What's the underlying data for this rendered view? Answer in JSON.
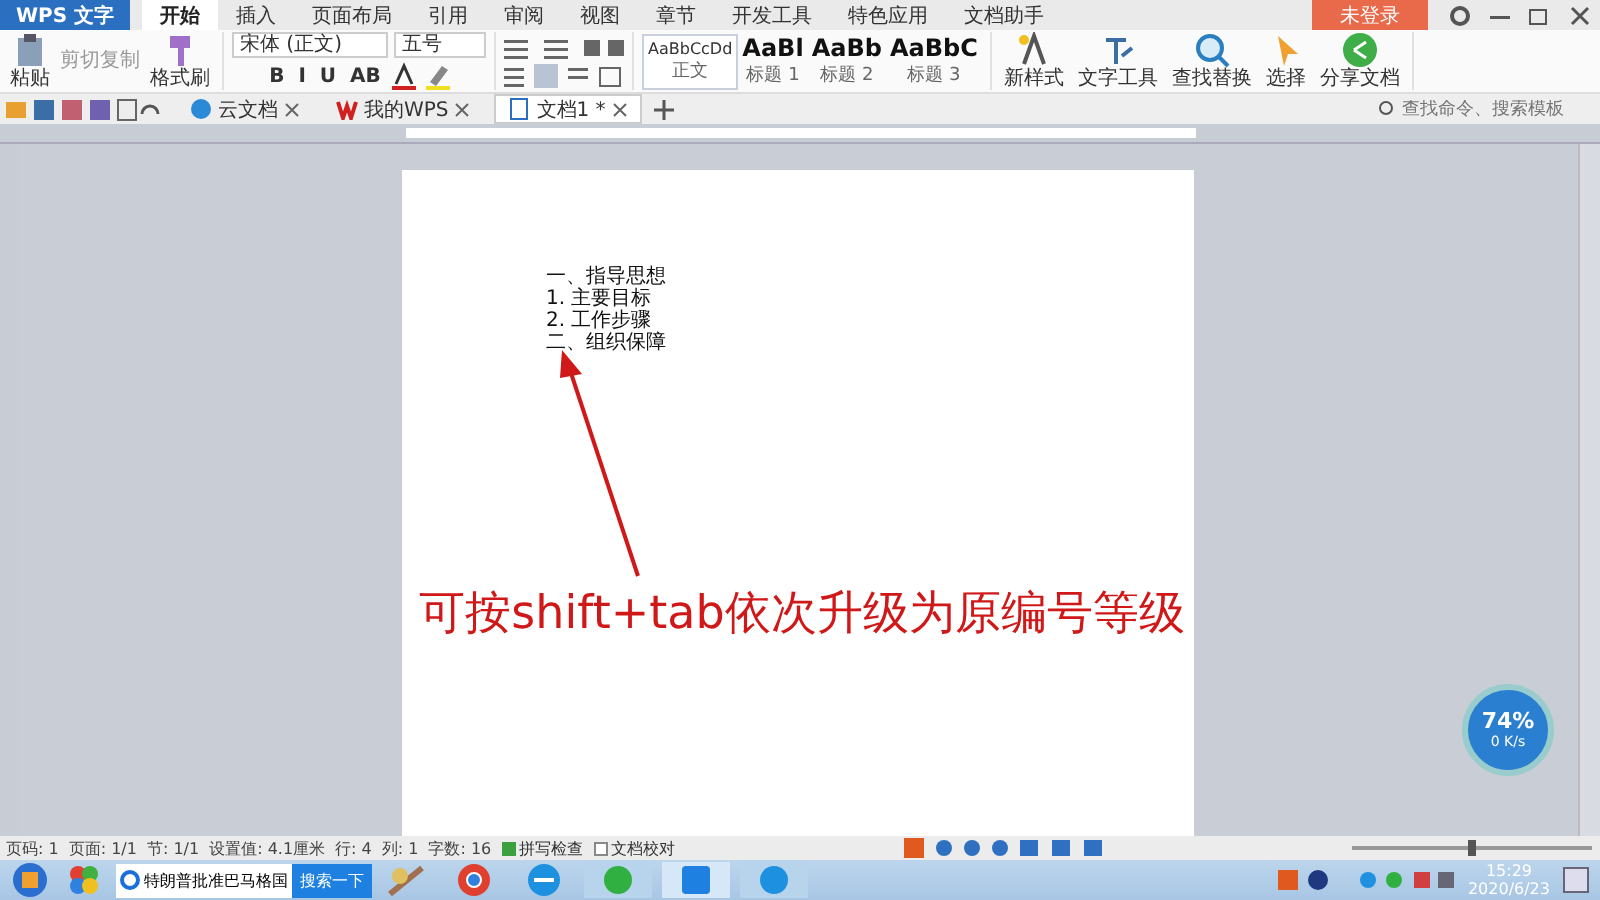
{
  "app_menu": {
    "label": "WPS 文字"
  },
  "tabs": [
    {
      "label": "开始",
      "selected": true
    },
    {
      "label": "插入",
      "selected": false
    },
    {
      "label": "页面布局",
      "selected": false
    },
    {
      "label": "引用",
      "selected": false
    },
    {
      "label": "审阅",
      "selected": false
    },
    {
      "label": "视图",
      "selected": false
    },
    {
      "label": "章节",
      "selected": false
    },
    {
      "label": "开发工具",
      "selected": false
    },
    {
      "label": "特色应用",
      "selected": false
    },
    {
      "label": "文档助手",
      "selected": false
    }
  ],
  "login_button": "未登录",
  "ribbon": {
    "paste": "粘贴",
    "cut": "剪切",
    "copy": "复制",
    "format_painter": "格式刷",
    "font_name": "宋体 (正文)",
    "font_size": "五号",
    "format_buttons": [
      "B",
      "I",
      "U",
      "AB"
    ],
    "styles": [
      {
        "preview": "AaBbCcDd",
        "label": "正文",
        "kind": "body"
      },
      {
        "preview": "AaBl",
        "label": "标题 1",
        "kind": "heading"
      },
      {
        "preview": "AaBb",
        "label": "标题 2",
        "kind": "heading"
      },
      {
        "preview": "AaBbC",
        "label": "标题 3",
        "kind": "heading"
      }
    ],
    "tools": [
      {
        "label": "新样式",
        "kind": "style"
      },
      {
        "label": "文字工具",
        "kind": "text"
      },
      {
        "label": "查找替换",
        "kind": "find"
      },
      {
        "label": "选择",
        "kind": "select"
      },
      {
        "label": "分享文档",
        "kind": "share"
      }
    ]
  },
  "doc_tabs": [
    {
      "label": "云文档",
      "kind": "cloud",
      "selected": false
    },
    {
      "label": "我的WPS",
      "kind": "wps",
      "selected": false
    },
    {
      "label": "文档1 *",
      "kind": "doc",
      "selected": true
    }
  ],
  "command_search": {
    "placeholder": "查找命令、搜索模板"
  },
  "document": {
    "lines": [
      "一、指导思想",
      "1. 主要目标",
      "2. 工作步骤",
      "二、组织保障"
    ]
  },
  "annotation": "可按shift+tab依次升级为原编号等级",
  "speed_meter": {
    "percent": "74%",
    "rate": "0 K/s"
  },
  "status_bar": {
    "items": [
      "页码: 1",
      "页面: 1/1",
      "节: 1/1",
      "设置值: 4.1厘米",
      "行: 4",
      "列: 1",
      "字数: 16"
    ],
    "checks": [
      {
        "label": "拼写检查",
        "checked": true
      },
      {
        "label": "文档校对",
        "checked": false
      }
    ]
  },
  "zoom_slider": {
    "level": 0.5
  },
  "taskbar": {
    "search": {
      "value": "特朗普批准巴马格国",
      "button": "搜索一下"
    },
    "clock": {
      "time": "15:29",
      "date": "2020/6/23"
    }
  }
}
